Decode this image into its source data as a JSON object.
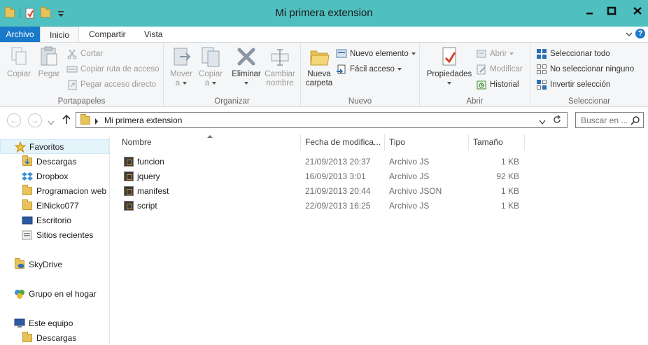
{
  "window": {
    "title": "Mi primera extension"
  },
  "ribbon_tabs": {
    "file": "Archivo",
    "home": "Inicio",
    "share": "Compartir",
    "view": "Vista"
  },
  "portapapeles": {
    "copy": "Copiar",
    "paste": "Pegar",
    "cut": "Cortar",
    "copy_path": "Copiar ruta de acceso",
    "paste_shortcut": "Pegar acceso directo",
    "label": "Portapapeles"
  },
  "organizar": {
    "move_line1": "Mover",
    "move_line2": "a",
    "copy_line1": "Copiar",
    "copy_line2": "a",
    "delete": "Eliminar",
    "rename_line1": "Cambiar",
    "rename_line2": "nombre",
    "label": "Organizar"
  },
  "nuevo": {
    "new_folder_line1": "Nueva",
    "new_folder_line2": "carpeta",
    "new_item": "Nuevo elemento",
    "easy_access": "Fácil acceso",
    "label": "Nuevo"
  },
  "abrir": {
    "properties": "Propiedades",
    "open": "Abrir",
    "edit": "Modificar",
    "history": "Historial",
    "label": "Abrir"
  },
  "seleccionar": {
    "select_all": "Seleccionar todo",
    "select_none": "No seleccionar ninguno",
    "invert": "Invertir selección",
    "label": "Seleccionar"
  },
  "address": {
    "path": "Mi primera extension"
  },
  "search": {
    "placeholder": "Buscar en ..."
  },
  "nav_pane": {
    "favorites": "Favoritos",
    "items": [
      "Descargas",
      "Dropbox",
      "Programacion web",
      "ElNicko077",
      "Escritorio",
      "Sitios recientes"
    ],
    "skydrive": "SkyDrive",
    "homegroup": "Grupo en el hogar",
    "this_pc": "Este equipo",
    "this_pc_first": "Descargas"
  },
  "columns": {
    "name": "Nombre",
    "date": "Fecha de modifica...",
    "type": "Tipo",
    "size": "Tamaño"
  },
  "files": [
    {
      "name": "funcion",
      "date": "21/09/2013 20:37",
      "type": "Archivo JS",
      "size": "1 KB"
    },
    {
      "name": "jquery",
      "date": "16/09/2013 3:01",
      "type": "Archivo JS",
      "size": "92 KB"
    },
    {
      "name": "manifest",
      "date": "21/09/2013 20:44",
      "type": "Archivo JSON",
      "size": "1 KB"
    },
    {
      "name": "script",
      "date": "22/09/2013 16:25",
      "type": "Archivo JS",
      "size": "1 KB"
    }
  ],
  "colors": {
    "titlebar": "#4fbfbf",
    "file_tab": "#1979ca",
    "folder": "#e8c25b"
  }
}
